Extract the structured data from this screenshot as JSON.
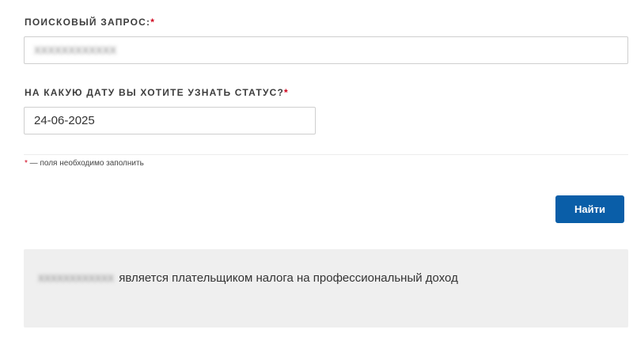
{
  "form": {
    "query_label": "ПОИСКОВЫЙ ЗАПРОС:",
    "query_required_mark": "*",
    "query_value": "XXXXXXXXXXXX",
    "date_label": "НА КАКУЮ ДАТУ ВЫ ХОТИТЕ УЗНАТЬ СТАТУС?",
    "date_required_mark": "*",
    "date_value": "24-06-2025",
    "note_mark": "*",
    "note_text": " — поля необходимо заполнить",
    "submit_label": "Найти"
  },
  "result": {
    "id_value": "XXXXXXXXXXXX",
    "text": " является плательщиком налога на профессиональный доход"
  },
  "colors": {
    "accent": "#0a5ea8",
    "required": "#d0021b",
    "result_bg": "#efefef"
  }
}
